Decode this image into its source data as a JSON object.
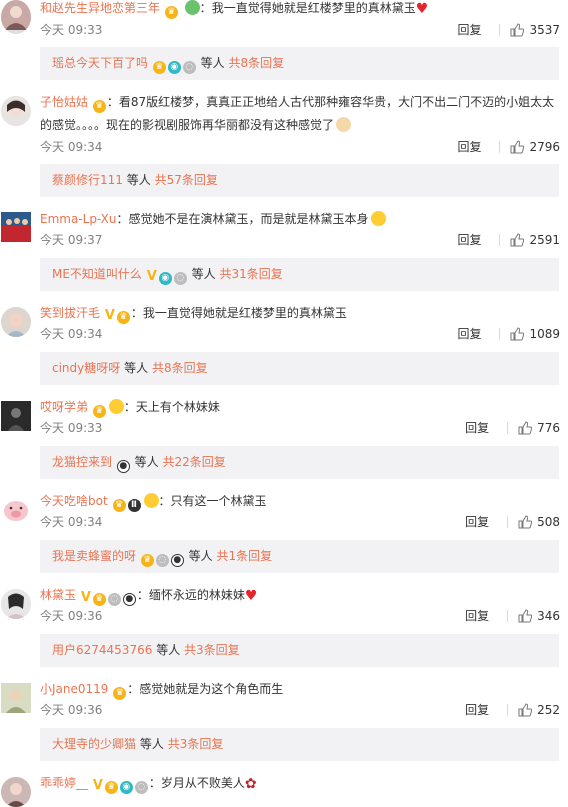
{
  "reply_label": "回复",
  "more_suffix_people": "等人",
  "comments": [
    {
      "user": "和赵先生异地恋第三年",
      "text": "我一直觉得她就是红楼梦里的真林黛玉",
      "time": "今天 09:33",
      "likes": "3537",
      "sub_user": "瑶总今天下百了吗",
      "sub_count": "共8条回复"
    },
    {
      "user": "子怡姑姑",
      "text": "看87版红楼梦，真真正正地给人古代那种雍容华贵，大门不出二门不迈的小姐太太",
      "text2": "的感觉。。。。现在的影视剧服饰再华丽都没有这种感觉了",
      "time": "今天 09:34",
      "likes": "2796",
      "sub_user": "蔡颜修行111",
      "sub_count": "共57条回复"
    },
    {
      "user": "Emma-Lp-Xu",
      "text": "感觉她不是在演林黛玉，而是就是林黛玉本身",
      "time": "今天 09:37",
      "likes": "2591",
      "sub_user": "ME不知道叫什么",
      "sub_count": "共31条回复"
    },
    {
      "user": "笑到拔汗毛",
      "text": "我一直觉得她就是红楼梦里的真林黛玉",
      "time": "今天 09:34",
      "likes": "1089",
      "sub_user": "cindy糖呀呀",
      "sub_count": "共8条回复"
    },
    {
      "user": "哎呀学弟",
      "text": "天上有个林妹妹",
      "time": "今天 09:33",
      "likes": "776",
      "sub_user": "龙猫控来到",
      "sub_count": "共22条回复"
    },
    {
      "user": "今天吃啥bot",
      "text": "只有这一个林黛玉",
      "time": "今天 09:34",
      "likes": "508",
      "sub_user": "我是卖蜂蜜的呀",
      "sub_count": "共1条回复"
    },
    {
      "user": "林黛玉",
      "text": "缅怀永远的林妹妹",
      "time": "今天 09:36",
      "likes": "346",
      "sub_user": "用户6274453766",
      "sub_count": "共3条回复"
    },
    {
      "user": "小Jane0119",
      "text": "感觉她就是为这个角色而生",
      "time": "今天 09:36",
      "likes": "252",
      "sub_user": "大理寺的少卿猫",
      "sub_count": "共3条回复"
    },
    {
      "user": "乖乖婷__",
      "text": "岁月从不败美人"
    }
  ],
  "colors": {
    "username": "#eb7350",
    "time": "#808080",
    "reply_box_bg": "#f2f2f5",
    "heart": "#e4262c"
  }
}
